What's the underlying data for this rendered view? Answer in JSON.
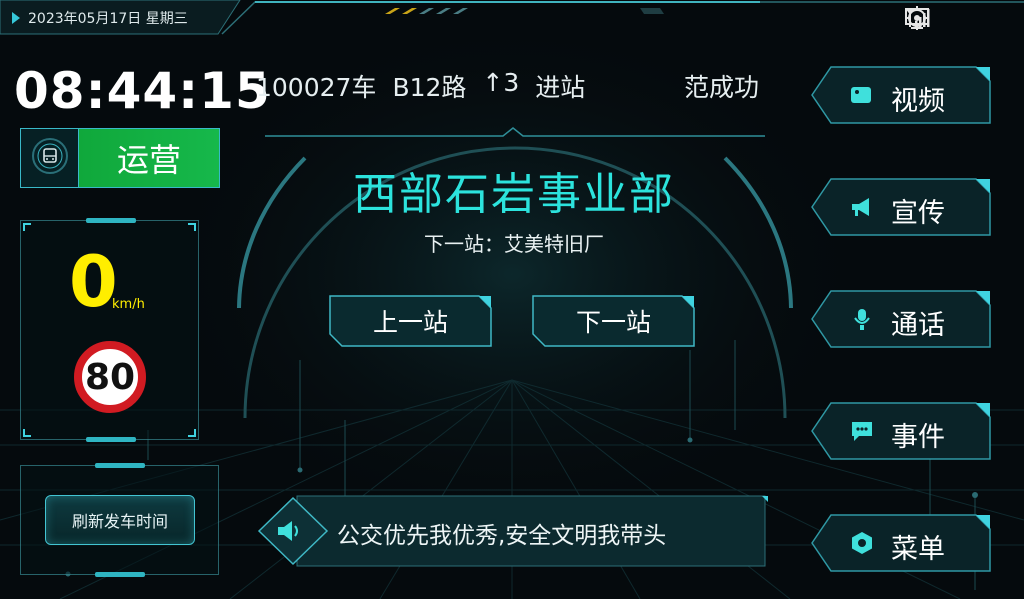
{
  "statusbar": {
    "date": "2023年05月17日 星期三",
    "icons": [
      "signal-icon",
      "gps-target-icon",
      "monitor-icon"
    ]
  },
  "left": {
    "clock": "08:44:15",
    "status_label": "运营",
    "status_icon": "bus-icon",
    "speed": "0",
    "speed_unit": "km/h",
    "speed_limit": "80",
    "refresh_label": "刷新发车时间"
  },
  "header": {
    "vehicle": "100027车",
    "route": "B12路",
    "direction_arrow": "↑",
    "direction_number": "3",
    "stop_state": "进站",
    "driver": "范成功"
  },
  "center": {
    "station_name": "西部石岩事业部",
    "next_stop_label": "下一站：艾美特旧厂",
    "prev_button": "上一站",
    "next_button": "下一站"
  },
  "announcement": {
    "icon": "speaker-icon",
    "text": "公交优先我优秀,安全文明我带头"
  },
  "menu": {
    "video": "视频",
    "broadcast": "宣传",
    "call": "通话",
    "event": "事件",
    "menu": "菜单"
  },
  "colors": {
    "accent": "#2ce3dd",
    "status_green": "#16b84b",
    "speed_yellow": "#ffee00",
    "limit_red": "#d11b22",
    "frame_cyan": "#39b9c8"
  }
}
